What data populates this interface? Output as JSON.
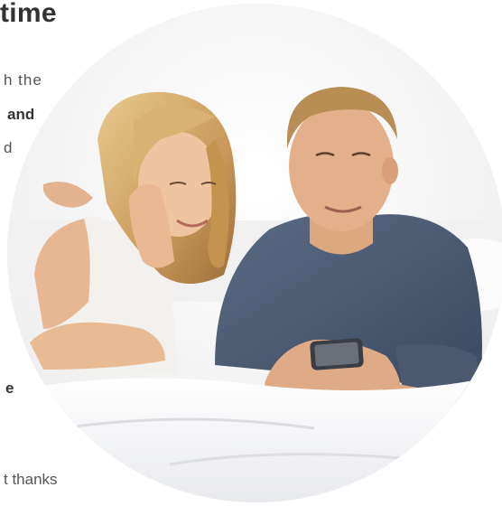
{
  "section": {
    "heading": "time",
    "text_fragments": [
      {
        "text": "h  the",
        "bold": false
      },
      {
        "text": "and",
        "bold": true
      },
      {
        "text": "d",
        "bold": false
      },
      {
        "text": "e",
        "bold": true
      },
      {
        "text": "t thanks",
        "bold": false
      }
    ]
  },
  "photo": {
    "description_icon": "couple-with-phone-photo"
  },
  "colors": {
    "heading": "#333333",
    "body_text": "#555555",
    "background": "#ffffff"
  }
}
